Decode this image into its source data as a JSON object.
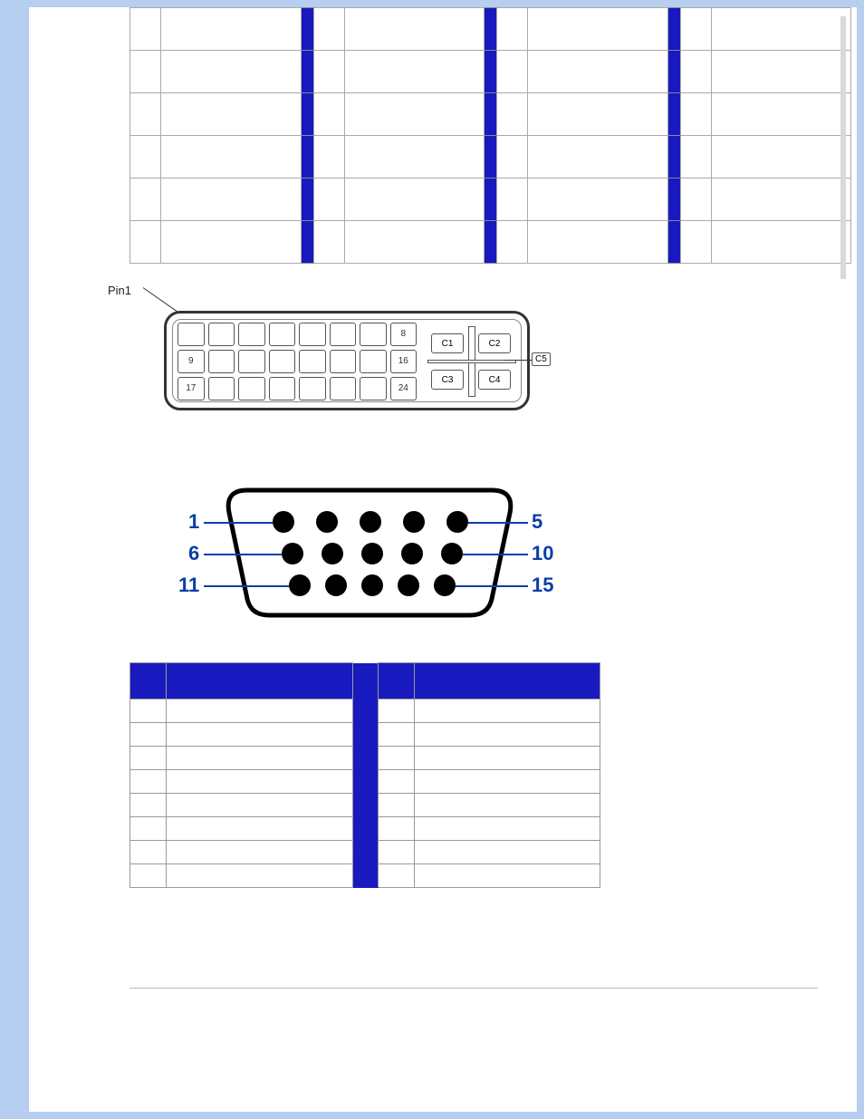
{
  "dvi": {
    "pin1_label": "Pin1",
    "visible_pins": {
      "p8": "8",
      "p9": "9",
      "p16": "16",
      "p17": "17",
      "p24": "24"
    },
    "c_pins": {
      "c1": "C1",
      "c2": "C2",
      "c3": "C3",
      "c4": "C4",
      "c5": "C5"
    }
  },
  "vga": {
    "labels": {
      "l1": "1",
      "l5": "5",
      "l6": "6",
      "l10": "10",
      "l11": "11",
      "l15": "15"
    }
  },
  "top_table": {
    "rows": 6,
    "cols": 4,
    "note": "cells are empty in the visible crop"
  },
  "bottom_table": {
    "header_left_num": "",
    "header_left_desc": "",
    "header_right_num": "",
    "header_right_desc": "",
    "left_rows": [
      {
        "n": "",
        "d": ""
      },
      {
        "n": "",
        "d": ""
      },
      {
        "n": "",
        "d": ""
      },
      {
        "n": "",
        "d": ""
      },
      {
        "n": "",
        "d": ""
      },
      {
        "n": "",
        "d": ""
      },
      {
        "n": "",
        "d": ""
      },
      {
        "n": "",
        "d": ""
      }
    ],
    "right_rows": [
      {
        "n": "",
        "d": ""
      },
      {
        "n": "",
        "d": ""
      },
      {
        "n": "",
        "d": ""
      },
      {
        "n": "",
        "d": ""
      },
      {
        "n": "",
        "d": ""
      },
      {
        "n": "",
        "d": ""
      },
      {
        "n": "",
        "d": ""
      }
    ]
  }
}
